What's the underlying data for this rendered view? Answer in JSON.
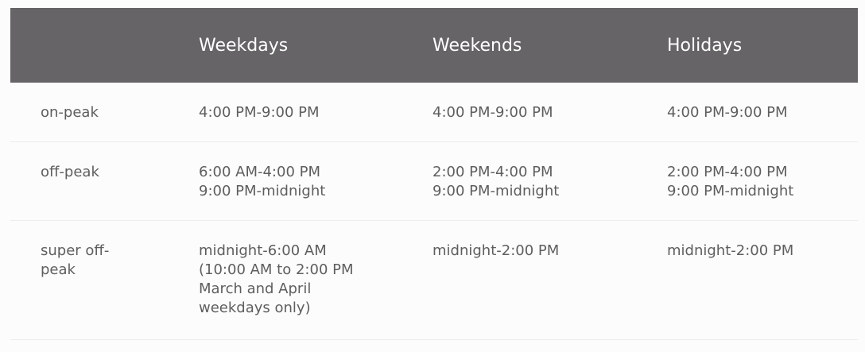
{
  "table": {
    "headers": [
      "",
      "Weekdays",
      "Weekends",
      "Holidays"
    ],
    "rows": [
      {
        "label": "on-peak",
        "weekdays": [
          "4:00 PM-9:00 PM"
        ],
        "weekends": [
          "4:00 PM-9:00 PM"
        ],
        "holidays": [
          "4:00 PM-9:00 PM"
        ]
      },
      {
        "label": "off-peak",
        "weekdays": [
          "6:00 AM-4:00 PM",
          "9:00 PM-midnight"
        ],
        "weekends": [
          "2:00 PM-4:00 PM",
          "9:00 PM-midnight"
        ],
        "holidays": [
          "2:00 PM-4:00 PM",
          "9:00 PM-midnight"
        ]
      },
      {
        "label": "super off-peak",
        "weekdays": [
          "midnight-6:00 AM",
          "(10:00 AM to 2:00 PM March and April weekdays only)"
        ],
        "weekends": [
          "midnight-2:00 PM"
        ],
        "holidays": [
          "midnight-2:00 PM"
        ]
      }
    ]
  },
  "colors": {
    "header_bg": "#666466",
    "header_text": "#ffffff",
    "body_text": "#5e5e5e",
    "row_divider": "#ececec",
    "page_bg": "#fcfcfc"
  }
}
